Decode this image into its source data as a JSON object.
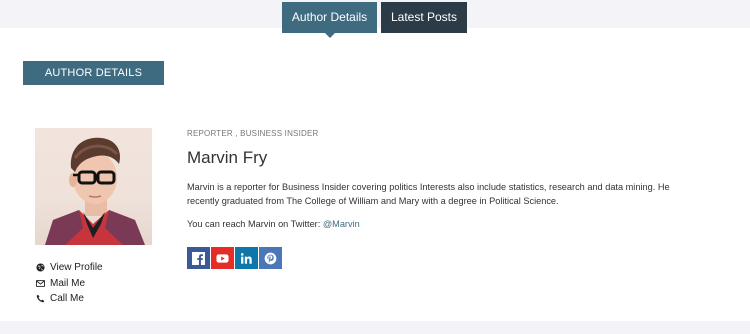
{
  "tabs": [
    {
      "label": "Author Details",
      "active": true
    },
    {
      "label": "Latest Posts",
      "active": false
    }
  ],
  "section": {
    "title": "AUTHOR DETAILS"
  },
  "author": {
    "role": "REPORTER , BUSINESS INSIDER",
    "name": "Marvin Fry",
    "bio": "Marvin is a reporter for Business Insider covering politics Interests also include statistics, research and data mining. He recently graduated from The College of William and Mary with a degree in Political Science.",
    "reach_text": "You can reach Marvin on Twitter: ",
    "twitter_handle": "@Marvin"
  },
  "contact_links": [
    {
      "label": "View Profile",
      "icon": "globe-icon"
    },
    {
      "label": "Mail Me",
      "icon": "mail-icon"
    },
    {
      "label": "Call Me",
      "icon": "phone-icon"
    }
  ],
  "socials": [
    {
      "name": "facebook",
      "icon": "facebook-icon",
      "color": "#3b5998"
    },
    {
      "name": "youtube",
      "icon": "youtube-icon",
      "color": "#e52d27"
    },
    {
      "name": "linkedin",
      "icon": "linkedin-icon",
      "color": "#0e76a8"
    },
    {
      "name": "pinterest",
      "icon": "pinterest-icon",
      "color": "#4a77b8"
    }
  ],
  "colors": {
    "accent": "#3f6b80",
    "tab_inactive": "#2b3b48",
    "card_bg": "#ffffff",
    "page_bg": "#f4f3f7"
  }
}
